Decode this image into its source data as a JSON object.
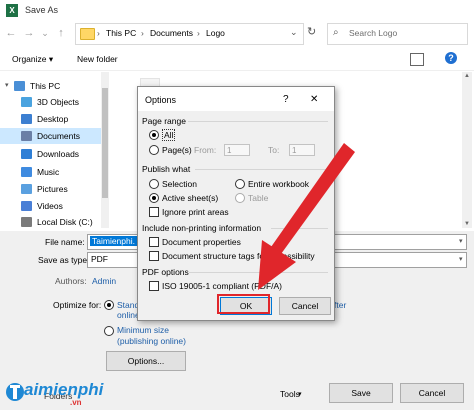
{
  "window": {
    "title": "Save As",
    "app_icon_letter": "X"
  },
  "nav": {
    "back": "←",
    "forward": "→",
    "recent": "⌄",
    "up": "↑",
    "breadcrumb": [
      "This PC",
      "Documents",
      "Logo"
    ],
    "separator": "›",
    "search_placeholder": "Search Logo"
  },
  "toolbar": {
    "organize": "Organize ▾",
    "new_folder": "New folder"
  },
  "sidebar": {
    "items": [
      {
        "label": "This PC",
        "color": "#4a8fd6"
      },
      {
        "label": "3D Objects",
        "color": "#4aa3df"
      },
      {
        "label": "Desktop",
        "color": "#3c7fd1"
      },
      {
        "label": "Documents",
        "color": "#6a7fa6"
      },
      {
        "label": "Downloads",
        "color": "#2f7fd6"
      },
      {
        "label": "Music",
        "color": "#3f8be0"
      },
      {
        "label": "Pictures",
        "color": "#5aa0e0"
      },
      {
        "label": "Videos",
        "color": "#4a7fd6"
      },
      {
        "label": "Local Disk (C:)",
        "color": "#7a7a7a"
      }
    ],
    "selected_index": 3
  },
  "form": {
    "file_name_label": "File name:",
    "file_name_value": "Taimienphi.",
    "save_as_type_label": "Save as type:",
    "save_as_type_value": "PDF",
    "authors_label": "Authors:",
    "authors_value": "Admin",
    "optimize_label": "Optimize for:",
    "opt_standard": "Stand",
    "opt_standard_2": "online",
    "opt_minimum": "Minimum size",
    "opt_minimum_2": "(publishing online)",
    "after_text": "fter",
    "options_button": "Options...",
    "hide_folders": "Folders",
    "tools": "Tools",
    "save": "Save",
    "cancel": "Cancel"
  },
  "dialog": {
    "title": "Options",
    "help": "?",
    "close": "✕",
    "page_range": "Page range",
    "all": "All",
    "pages": "Page(s)",
    "from": "From:",
    "to": "To:",
    "from_value": "1",
    "to_value": "1",
    "publish_what": "Publish what",
    "selection": "Selection",
    "entire_workbook": "Entire workbook",
    "active_sheets": "Active sheet(s)",
    "table": "Table",
    "ignore_print_areas": "Ignore print areas",
    "nonprinting": "Include non-printing information",
    "doc_properties": "Document properties",
    "doc_structure": "Document structure tags for accessibility",
    "pdf_options": "PDF options",
    "iso": "ISO 19005-1 compliant (PDF/A)",
    "ok": "OK",
    "cancel": "Cancel"
  },
  "watermark": {
    "brand": "aimienphi",
    "suffix": ".vn"
  },
  "colors": {
    "accent": "#0078d7",
    "highlight": "#e0262b",
    "selected_bg": "#cce8ff"
  }
}
